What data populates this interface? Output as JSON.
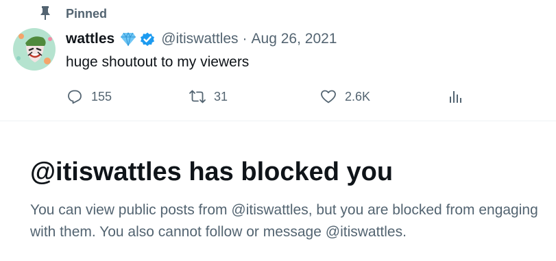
{
  "pinned": {
    "label": "Pinned"
  },
  "tweet": {
    "display_name": "wattles",
    "handle": "@itiswattles",
    "separator": "·",
    "date": "Aug 26, 2021",
    "text": "huge shoutout to my viewers",
    "badges": [
      "gem-icon",
      "verified-icon"
    ]
  },
  "actions": {
    "replies": "155",
    "reposts": "31",
    "likes": "2.6K"
  },
  "blocked": {
    "title": "@itiswattles has blocked you",
    "description": "You can view public posts from @itiswattles, but you are blocked from engaging with them. You also cannot follow or message @itiswattles."
  },
  "colors": {
    "text_primary": "#0f1419",
    "text_secondary": "#536471",
    "verified_blue": "#1d9bf0",
    "gem_blue": "#6fc6f5",
    "divider": "#eff3f4"
  }
}
